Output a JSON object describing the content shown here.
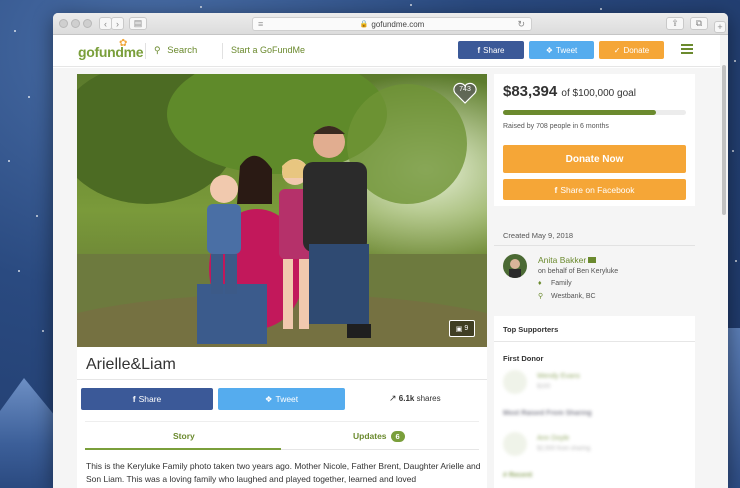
{
  "browser": {
    "url": "gofundme.com"
  },
  "nav": {
    "logo_go": "go",
    "logo_fund": "fund",
    "logo_me": "me",
    "search_label": "Search",
    "start_label": "Start a GoFundMe",
    "share_label": "Share",
    "tweet_label": "Tweet",
    "donate_label": "Donate"
  },
  "photo": {
    "heart_count": "743",
    "photo_count": "9"
  },
  "campaign": {
    "title": "Arielle&Liam",
    "share_label": "Share",
    "tweet_label": "Tweet",
    "shares_count": "6.1k",
    "shares_label": "shares",
    "tab_story": "Story",
    "tab_updates": "Updates",
    "updates_count": "6",
    "story_text": "This is the Keryluke Family photo taken two years ago. Mother Nicole, Father Brent, Daughter Arielle and Son Liam.  This was a loving family  who laughed and played together, learned and loved"
  },
  "goal": {
    "amount": "$83,394",
    "goal_text": "of $100,000 goal",
    "progress_fraction": 0.834,
    "raised_text": "Raised by 708 people in 6 months",
    "donate_now_label": "Donate Now",
    "share_facebook_label": "Share on Facebook"
  },
  "organizer": {
    "created": "Created May 9, 2018",
    "name": "Anita Bakker",
    "on_behalf": "on behalf of Ben Keryluke",
    "category": "Family",
    "location": "Westbank, BC"
  },
  "supporters": {
    "top_label": "Top Supporters",
    "first_donor_label": "First Donor",
    "first_donor_name": "Wendy Evans",
    "first_donor_amount": "$100",
    "most_raised_label": "Most Raised From Sharing",
    "most_raised_name": "Ann Doyle",
    "most_raised_amount": "$2,500 from sharing",
    "all_label": "# Recent"
  },
  "colors": {
    "brand_green": "#6b8a2e",
    "facebook": "#3b5998",
    "twitter": "#55acee",
    "donate_orange": "#f5a637"
  }
}
